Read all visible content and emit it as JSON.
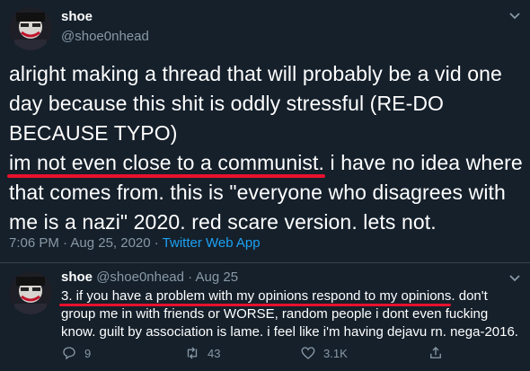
{
  "tweet": {
    "author_name": "shoe",
    "author_handle": "@shoe0nhead",
    "paragraph_1": "alright making a thread that will probably be a vid one day because this shit is oddly stressful (RE-DO BECAUSE TYPO)",
    "underlined_text": "im not even close to a communist.",
    "paragraph_2_rest": " i have no idea where that comes from. this is \"everyone who disagrees with me is a nazi\" 2020. red scare version. lets not.",
    "time": "7:06 PM · Aug 25, 2020 · ",
    "source": "Twitter Web App"
  },
  "reply": {
    "author_name": "shoe",
    "author_handle": "@shoe0nhead · Aug 25",
    "underlined_text": "3. if you have a problem with my opinions respond to my opinions.",
    "text_rest": " don't group me in with friends or WORSE, random people i dont even fucking know. guilt by association is lame. i feel like i'm having dejavu rn. nega-2016.",
    "actions": {
      "reply_count": "9",
      "retweet_count": "43",
      "like_count": "3.1K"
    }
  },
  "colors": {
    "background": "#15202b",
    "secondary_text": "#8899a6",
    "link": "#1da1f2",
    "annotation_red": "#e8112d"
  },
  "icons": [
    "chevron-down-icon",
    "reply-icon",
    "retweet-icon",
    "like-icon",
    "share-icon"
  ]
}
